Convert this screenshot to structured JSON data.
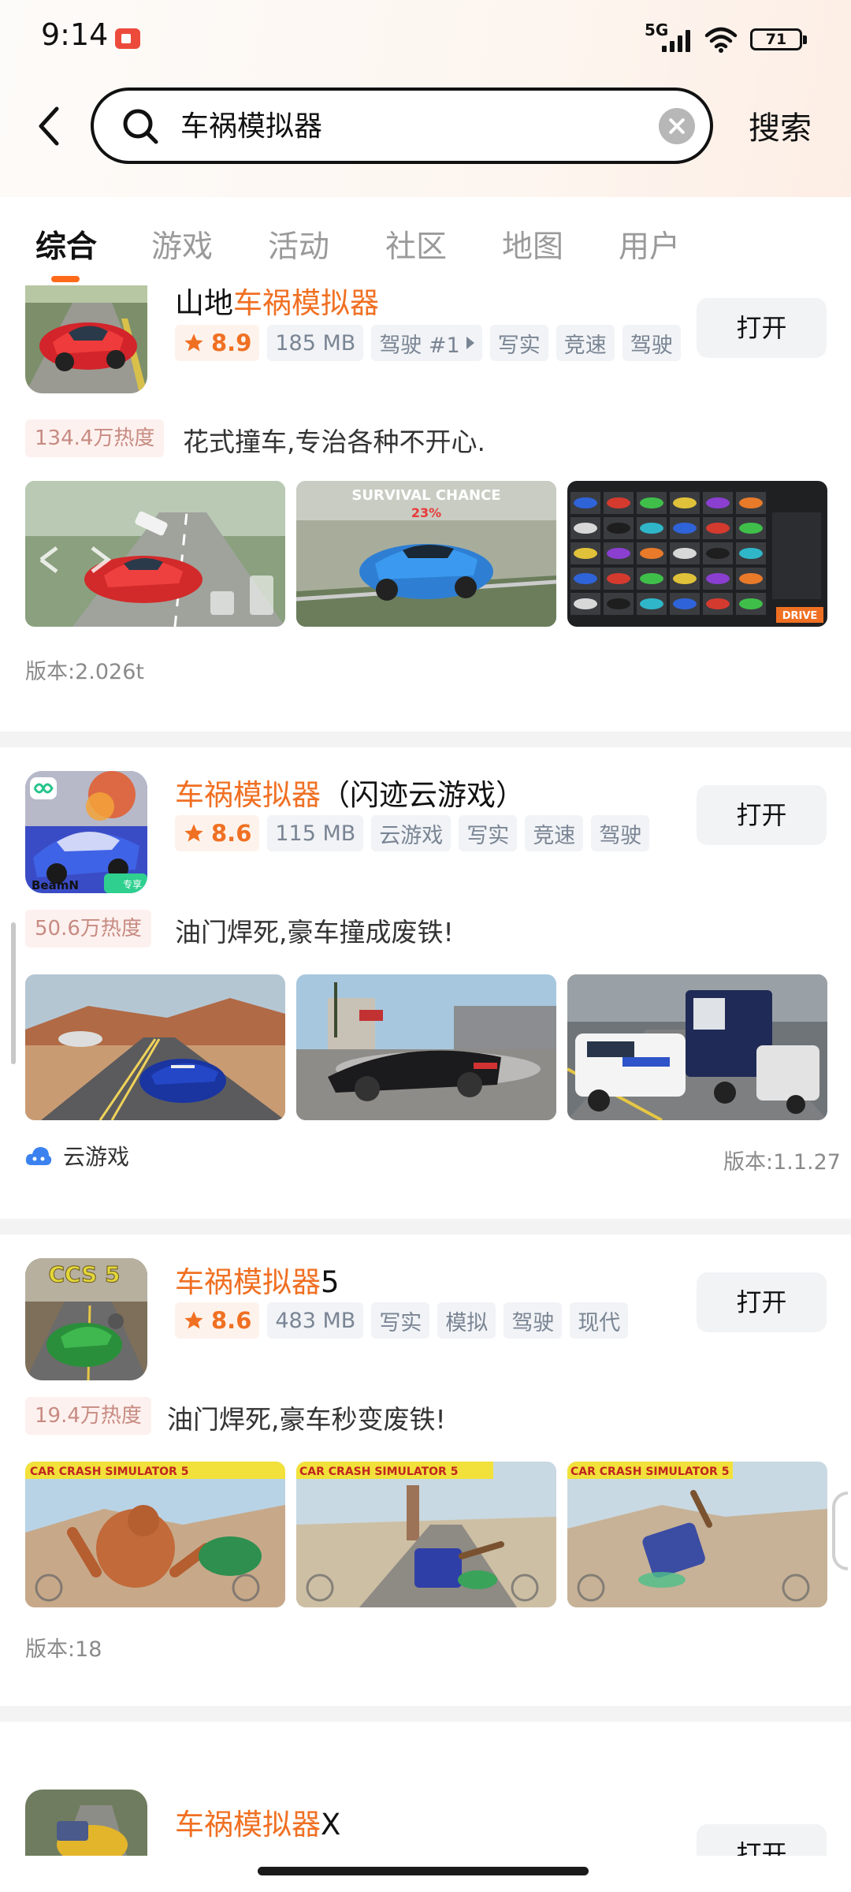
{
  "status_bar": {
    "time": "9:14",
    "network": "5G",
    "battery": "71"
  },
  "search": {
    "query": "车祸模拟器",
    "button_label": "搜索"
  },
  "tabs": [
    {
      "label": "综合",
      "active": true
    },
    {
      "label": "游戏"
    },
    {
      "label": "活动"
    },
    {
      "label": "社区"
    },
    {
      "label": "地图"
    },
    {
      "label": "用户"
    }
  ],
  "results": [
    {
      "title_prefix": "山地",
      "title_highlight": "车祸模拟器",
      "title_suffix": "",
      "rating": "8.9",
      "size": "185 MB",
      "tags": [
        "驾驶 #1",
        "写实",
        "竞速",
        "驾驶"
      ],
      "open_label": "打开",
      "heat": "134.4万热度",
      "slogan": "花式撞车,专治各种不开心.",
      "version": "版本:2.026t",
      "screenshot_captions": [
        "",
        "SURVIVAL CHANCE",
        "DRIVE"
      ],
      "survival_percent": "23%"
    },
    {
      "title_prefix": "",
      "title_highlight": "车祸模拟器",
      "title_suffix": "（闪迹云游戏）",
      "rating": "8.6",
      "size": "115 MB",
      "tags": [
        "云游戏",
        "写实",
        "竞速",
        "驾驶"
      ],
      "open_label": "打开",
      "heat": "50.6万热度",
      "slogan": "油门焊死,豪车撞成废铁!",
      "cloud_label": "云游戏",
      "version": "版本:1.1.27",
      "icon_text": "BeamN",
      "icon_badge": "专享"
    },
    {
      "title_prefix": "",
      "title_highlight": "车祸模拟器",
      "title_suffix": "5",
      "rating": "8.6",
      "size": "483 MB",
      "tags": [
        "写实",
        "模拟",
        "驾驶",
        "现代"
      ],
      "open_label": "打开",
      "heat": "19.4万热度",
      "slogan": "油门焊死,豪车秒变废铁!",
      "version": "版本:18",
      "icon_text": "CCS 5",
      "screenshot_caption": "CAR CRASH SIMULATOR 5"
    },
    {
      "title_prefix": "",
      "title_highlight": "车祸模拟器",
      "title_suffix": "X",
      "open_label": "打开"
    }
  ],
  "colors": {
    "accent": "#f07023",
    "tab_indicator": "#ff6a1a",
    "heat_text": "#c78b82"
  }
}
